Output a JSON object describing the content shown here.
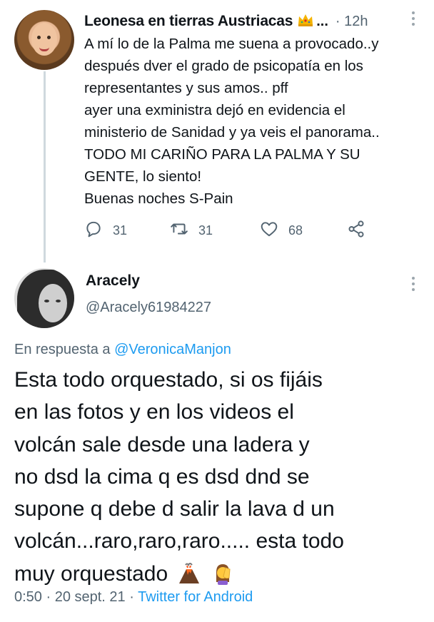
{
  "parent_tweet": {
    "name": "Leonesa en tierras Austriacas",
    "name_suffix": "...",
    "time": "· 12h",
    "text_lines": [
      "A mí lo de la Palma me suena a provocado..y",
      "después dver el grado de psicopatía en los",
      "representantes y sus amos.. pff",
      "ayer una exministra dejó en evidencia el",
      "ministerio de Sanidad y ya veis el panorama..",
      "TODO MI CARIÑO PARA LA PALMA Y SU",
      "GENTE, lo siento!",
      "Buenas noches S-Pain"
    ],
    "reply_count": "31",
    "retweet_count": "31",
    "like_count": "68"
  },
  "main_tweet": {
    "name": "Aracely",
    "handle": "@Aracely61984227",
    "reply_prefix": "En respuesta a ",
    "reply_mention": "@VeronicaManjon",
    "text_lines": [
      "Esta todo orquestado, si os fijáis",
      "en las fotos y en los videos el",
      "volcán sale desde una ladera y",
      "no dsd la cima q es dsd dnd se",
      "supone q debe d salir la lava d un",
      "volcán...raro,raro,raro..... esta todo",
      "muy orquestado"
    ],
    "time": "0:50 · 20 sept. 21 · ",
    "source": "Twitter for Android"
  },
  "colors": {
    "text": "#0f1419",
    "secondary": "#536471",
    "link": "#1d9bf0",
    "thread_line": "#cfd9de"
  },
  "icons": [
    "reply-icon",
    "retweet-icon",
    "like-icon",
    "share-icon",
    "more-icon",
    "crown-icon",
    "volcano-icon",
    "facepalm-icon"
  ]
}
